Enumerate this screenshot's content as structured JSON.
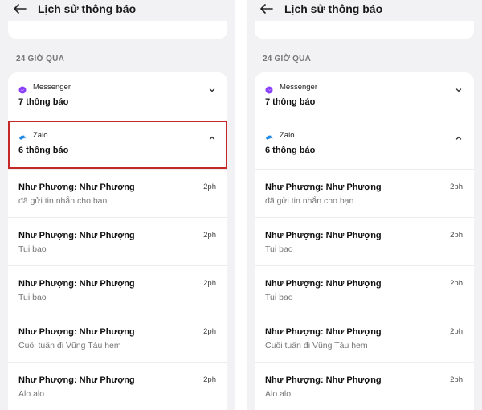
{
  "header": {
    "title": "Lịch sử thông báo"
  },
  "section": {
    "label": "24 GIỜ QUA"
  },
  "groups": [
    {
      "app": "Messenger",
      "count_label": "7 thông báo",
      "expanded": false,
      "icon": "messenger-icon",
      "color": "#8a3ffc"
    },
    {
      "app": "Zalo",
      "count_label": "6 thông báo",
      "expanded": true,
      "icon": "zalo-icon",
      "color": "#1e88e5"
    }
  ],
  "notifications": [
    {
      "sender": "Như Phượng: Như Phượng",
      "message": "đã gửi tin nhắn cho bạn",
      "time": "2ph"
    },
    {
      "sender": "Như Phượng: Như Phượng",
      "message": "Tui bao",
      "time": "2ph"
    },
    {
      "sender": "Như Phượng: Như Phượng",
      "message": "Tui bao",
      "time": "2ph"
    },
    {
      "sender": "Như Phượng: Như Phượng",
      "message": "Cuối tuần đi Vũng Tàu hem",
      "time": "2ph"
    },
    {
      "sender": "Như Phượng: Như Phượng",
      "message": "Alo alo",
      "time": "2ph"
    }
  ],
  "highlight_color": "#c62828"
}
